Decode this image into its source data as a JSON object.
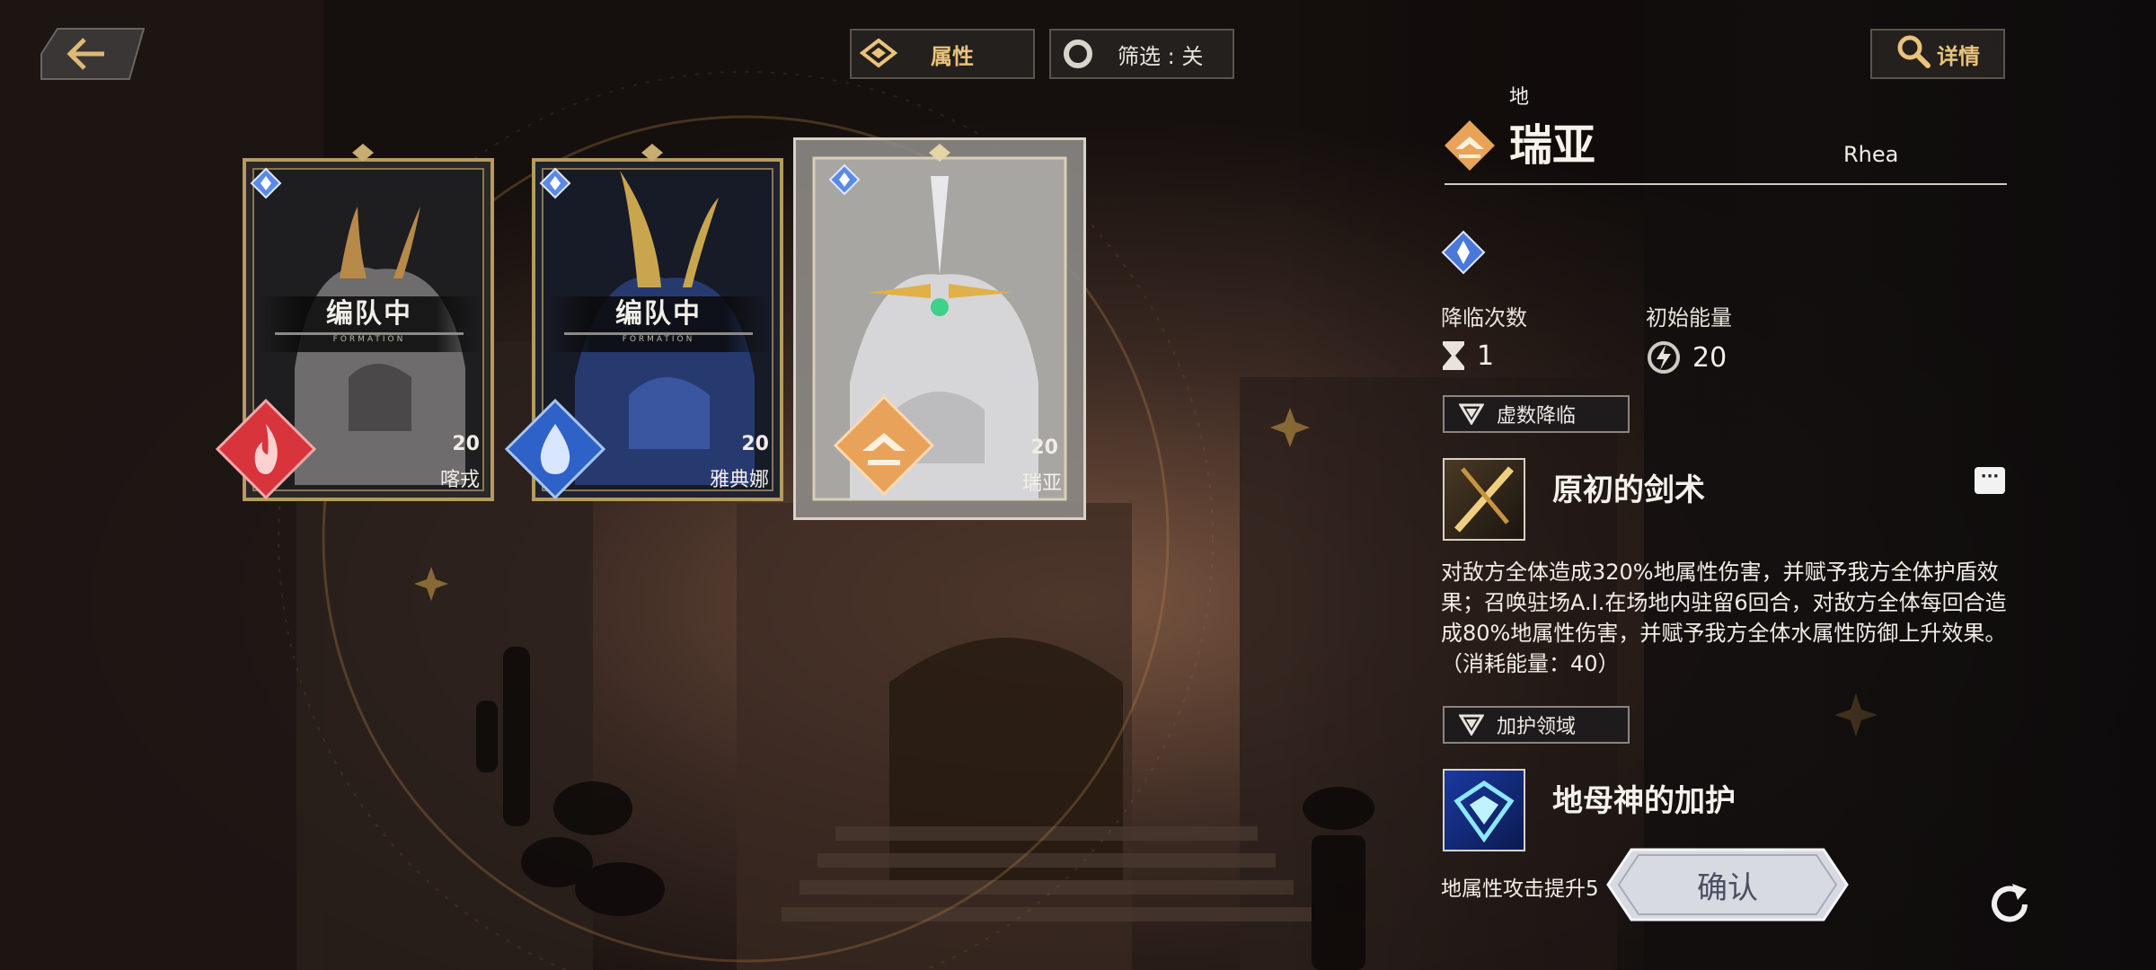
{
  "topbar": {
    "attribute_label": "属性",
    "filter_label": "筛选 : 关",
    "detail_label": "详情"
  },
  "cards": [
    {
      "name": "喀戎",
      "energy": "20",
      "status": "编队中",
      "status_sub": "FORMATION",
      "element": "fire",
      "color": "#d8343c"
    },
    {
      "name": "雅典娜",
      "energy": "20",
      "status": "编队中",
      "status_sub": "FORMATION",
      "element": "water",
      "color": "#2f62c8"
    },
    {
      "name": "瑞亚",
      "energy": "20",
      "status": "",
      "status_sub": "",
      "element": "earth",
      "color": "#e8a25a",
      "selected": true
    }
  ],
  "detail": {
    "element": "地",
    "name": "瑞亚",
    "name_en": "Rhea",
    "descent_count_label": "降临次数",
    "descent_count": "1",
    "initial_energy_label": "初始能量",
    "initial_energy": "20",
    "active_tag": "虚数降临",
    "active_skill_name": "原初的剑术",
    "active_skill_desc": "对敌方全体造成320%地属性伤害，并赋予我方全体护盾效果；召唤驻场A.I.在场地内驻留6回合，对敌方全体每回合造成80%地属性伤害，并赋予我方全体水属性防御上升效果。（消耗能量：40）",
    "passive_tag": "加护领域",
    "passive_skill_name": "地母神的加护",
    "passive_skill_desc": "地属性攻击提升5"
  },
  "confirm_label": "确认",
  "colors": {
    "gold": "#e9c37a",
    "earth": "#e8a25a"
  }
}
